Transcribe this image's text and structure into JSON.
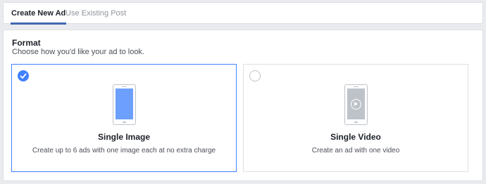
{
  "tabs": [
    {
      "label": "Create New Ad",
      "active": true
    },
    {
      "label": "Use Existing Post",
      "active": false
    }
  ],
  "format": {
    "title": "Format",
    "subtitle": "Choose how you'd like your ad to look."
  },
  "options": [
    {
      "title": "Single Image",
      "description": "Create up to 6 ads with one image each at no extra charge",
      "selected": true,
      "icon": "phone-image-icon"
    },
    {
      "title": "Single Video",
      "description": "Create an ad with one video",
      "selected": false,
      "icon": "phone-video-icon"
    }
  ],
  "colors": {
    "accent": "#4080ff",
    "tab_indicator": "#4267b2",
    "background": "#e9ebee"
  }
}
